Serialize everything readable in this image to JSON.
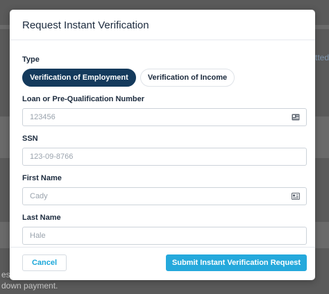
{
  "background": {
    "right_snippet": "tted",
    "bottom_line_1": "es. F",
    "bottom_line_2": "down payment."
  },
  "modal": {
    "title": "Request Instant Verification",
    "type": {
      "label": "Type",
      "options": [
        {
          "label": "Verification of Employment",
          "selected": true
        },
        {
          "label": "Verification of Income",
          "selected": false
        }
      ]
    },
    "loan_number": {
      "label": "Loan or Pre-Qualification Number",
      "placeholder": "123456",
      "value": "",
      "icon": "id-card-icon"
    },
    "ssn": {
      "label": "SSN",
      "placeholder": "123-09-8766",
      "value": ""
    },
    "first_name": {
      "label": "First Name",
      "placeholder": "Cady",
      "value": "",
      "icon": "contact-card-icon"
    },
    "last_name": {
      "label": "Last Name",
      "placeholder": "Hale",
      "value": ""
    },
    "footer": {
      "cancel_label": "Cancel",
      "submit_label": "Submit Instant Verification Request"
    }
  },
  "colors": {
    "primary_dark": "#143a5c",
    "accent": "#25a9dc",
    "overlay": "#5a5a5a"
  }
}
